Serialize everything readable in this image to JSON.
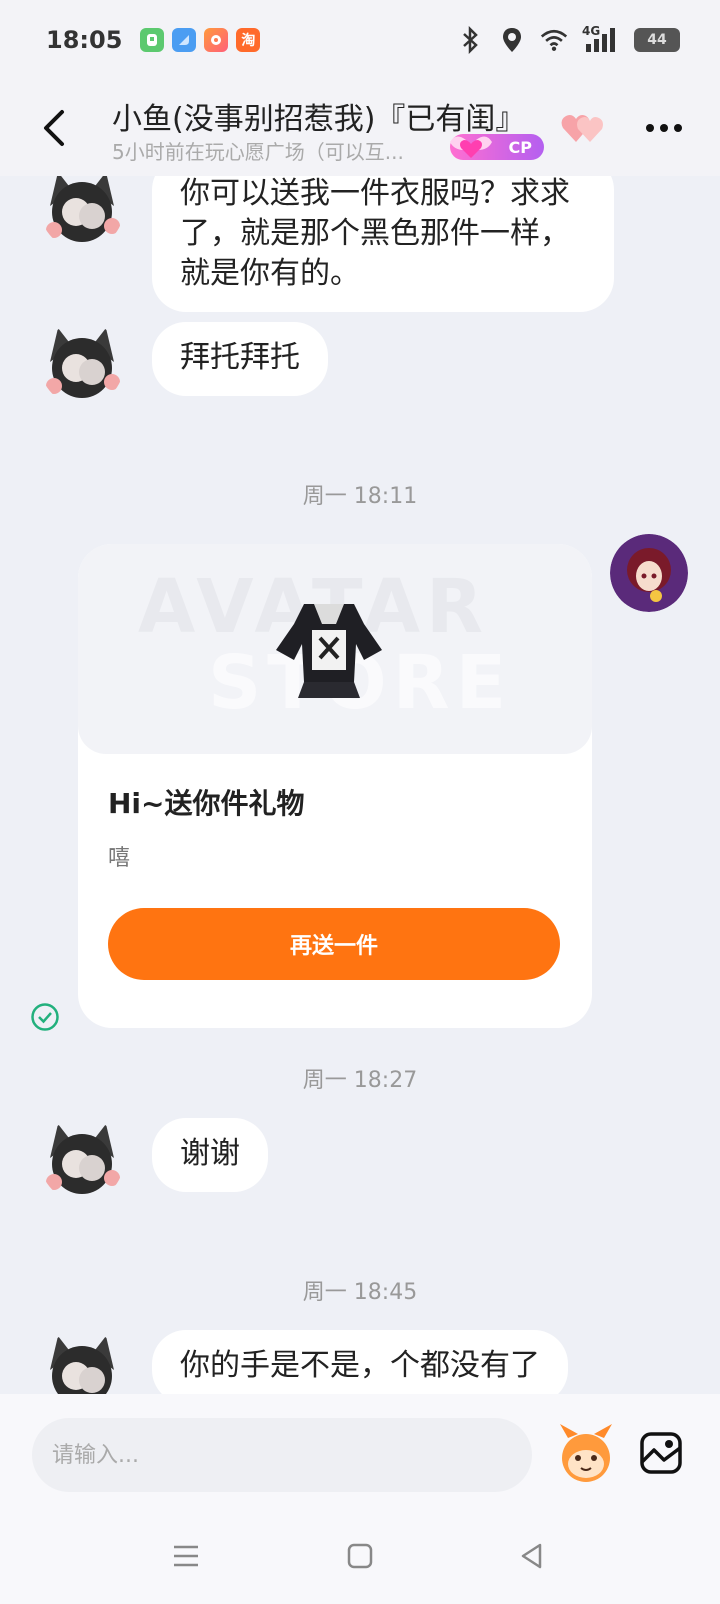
{
  "status_bar": {
    "time": "18:05",
    "network": "4G",
    "battery": "44",
    "app_icons": [
      "app-green-icon",
      "app-blue-icon",
      "app-colorful-icon",
      "taobao-icon"
    ],
    "taobao_glyph": "淘"
  },
  "header": {
    "title": "小鱼(没事别招惹我)『已有闺』",
    "subtitle": "5小时前在玩心愿广场（可以互...",
    "badge": "CP"
  },
  "messages": [
    {
      "type": "text",
      "sender": "other",
      "lines": [
        "你可以送我一件衣服吗？求求",
        "了，就是那个黑色那件一样，",
        "就是你有的。"
      ]
    },
    {
      "type": "text",
      "sender": "other",
      "text": "拜托拜托"
    },
    {
      "type": "time",
      "text": "周一 18:11"
    },
    {
      "type": "gift",
      "sender": "me",
      "watermark_top": "AVATAR",
      "watermark_bottom": "STORE",
      "title": "Hi~送你件礼物",
      "note": "嘻",
      "button": "再送一件",
      "status": "sent"
    },
    {
      "type": "time",
      "text": "周一 18:27"
    },
    {
      "type": "text",
      "sender": "other",
      "text": "谢谢"
    },
    {
      "type": "time",
      "text": "周一 18:45"
    },
    {
      "type": "text",
      "sender": "other",
      "text": "你的手是不是，个都没有了"
    }
  ],
  "input": {
    "placeholder": "请输入..."
  },
  "colors": {
    "accent": "#ff7411",
    "background": "#eef0f6",
    "sent_check": "#22b07d",
    "cp_badge": "#b45ff0"
  }
}
